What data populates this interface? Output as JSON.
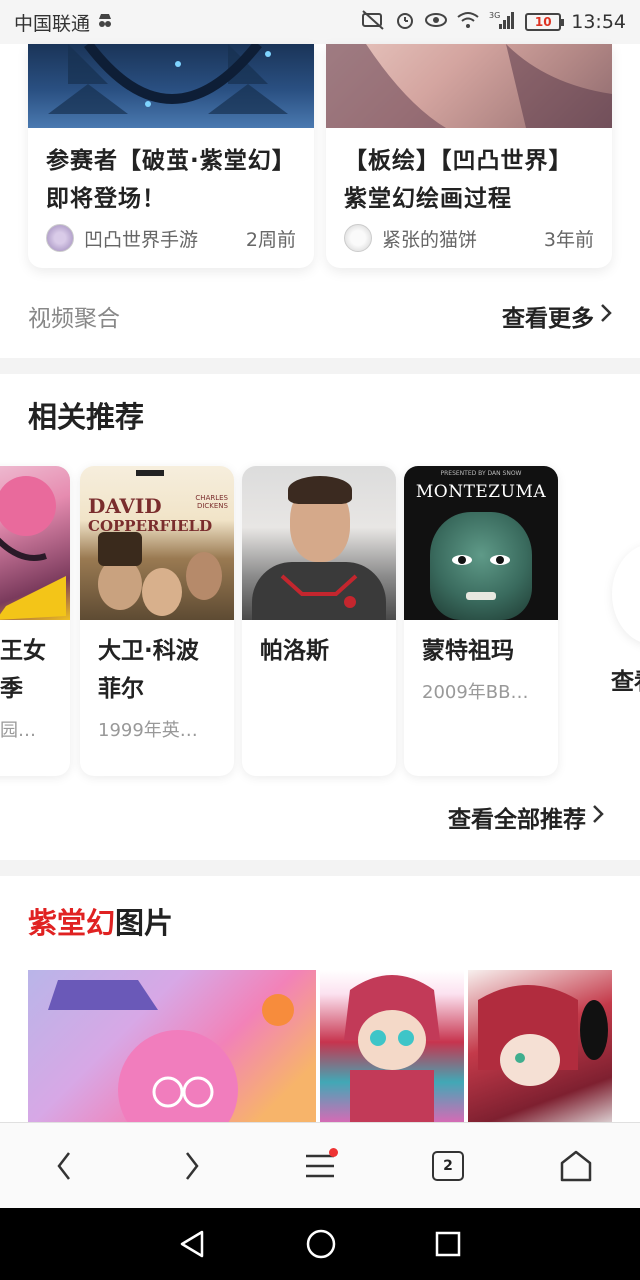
{
  "status_bar": {
    "carrier": "中国联通",
    "network": "3G",
    "battery": "10",
    "time": "13:54"
  },
  "video_cards": [
    {
      "title": "参赛者【破茧·紫堂幻】即将登场！",
      "author": "凹凸世界手游",
      "time": "2周前"
    },
    {
      "title": "【板绘】【凹凸世界】紫堂幻绘画过程",
      "author": "紧张的猫饼",
      "time": "3年前"
    }
  ],
  "video_agg": {
    "label": "视频聚合",
    "more": "查看更多"
  },
  "related": {
    "title": "相关推荐",
    "items": [
      {
        "name": "王女 季",
        "sub": "园…"
      },
      {
        "name": "大卫·科波菲尔",
        "sub": "1999年英…",
        "cover_text_1": "DAVID",
        "cover_text_2": "COPPERFIELD",
        "cover_small": "CHARLES DICKENS"
      },
      {
        "name": "帕洛斯",
        "sub": ""
      },
      {
        "name": "蒙特祖玛",
        "sub": "2009年BB…",
        "cover_text": "MONTEZUMA",
        "cover_small": "PRESENTED BY DAN SNOW"
      }
    ],
    "side_more": "查看",
    "see_all": "查看全部推荐"
  },
  "pictures": {
    "title_highlight": "紫堂幻",
    "title_rest": "图片"
  },
  "toolbar": {
    "tab_count": "2"
  },
  "colors": {
    "accent_red": "#e02222",
    "notify_dot": "#ee3333"
  }
}
